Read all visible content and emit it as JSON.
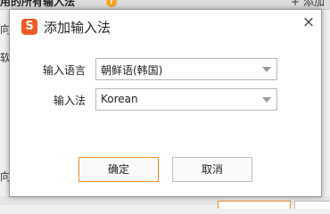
{
  "background": {
    "top_title": "用的所有输入法",
    "top_right": "+ 添加",
    "side_texts": [
      "向",
      "软",
      "向"
    ]
  },
  "dialog": {
    "icon_glyph": "S",
    "title": "添加输入法",
    "close_glyph": "×",
    "fields": {
      "language": {
        "label": "输入语言",
        "value": "朝鲜语(韩国)"
      },
      "ime": {
        "label": "输入法",
        "value": "Korean"
      }
    },
    "buttons": {
      "ok": "确定",
      "cancel": "取消"
    }
  },
  "colors": {
    "accent": "#f15a24",
    "ok_border": "#f08a2a"
  }
}
